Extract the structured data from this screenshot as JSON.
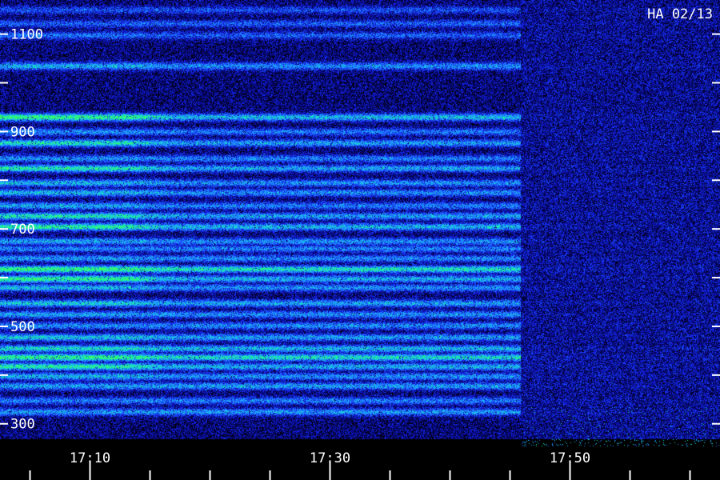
{
  "chart_data": {
    "type": "heatmap",
    "title": "HA 02/13",
    "xlabel": "",
    "ylabel": "",
    "x_tick_labels": [
      "17:10",
      "17:30",
      "17:50"
    ],
    "x_tick_values_min": [
      10,
      30,
      50
    ],
    "x_range_min": [
      2.5,
      62.5
    ],
    "x_minor_tick_step_min": 5,
    "y_tick_labels": [
      "300",
      "500",
      "700",
      "900",
      "1100"
    ],
    "y_tick_values": [
      300,
      500,
      700,
      900,
      1100
    ],
    "y_range": [
      270,
      1170
    ],
    "y_minor_tick_step": 100,
    "signal_cutoff_min": 45.9,
    "colormap": [
      "#000000",
      "#05047a",
      "#1520e8",
      "#1e6cff",
      "#1fb6ff",
      "#12f0a4",
      "#3dff5a"
    ],
    "bands": [
      {
        "y": 325,
        "level": 0.58,
        "early_boost": 0.0
      },
      {
        "y": 348,
        "level": 0.5,
        "early_boost": 0.0
      },
      {
        "y": 378,
        "level": 0.6,
        "early_boost": 0.0
      },
      {
        "y": 398,
        "level": 0.55,
        "early_boost": 0.1
      },
      {
        "y": 418,
        "level": 0.65,
        "early_boost": 0.2
      },
      {
        "y": 437,
        "level": 0.82,
        "early_boost": 0.15
      },
      {
        "y": 455,
        "level": 0.68,
        "early_boost": 0.1
      },
      {
        "y": 478,
        "level": 0.6,
        "early_boost": 0.1
      },
      {
        "y": 502,
        "level": 0.55,
        "early_boost": 0.0
      },
      {
        "y": 525,
        "level": 0.55,
        "early_boost": 0.05
      },
      {
        "y": 548,
        "level": 0.62,
        "early_boost": 0.1
      },
      {
        "y": 580,
        "level": 0.55,
        "early_boost": 0.1
      },
      {
        "y": 598,
        "level": 0.65,
        "early_boost": 0.25
      },
      {
        "y": 618,
        "level": 0.85,
        "early_boost": 0.15
      },
      {
        "y": 640,
        "level": 0.52,
        "early_boost": 0.05
      },
      {
        "y": 660,
        "level": 0.5,
        "early_boost": 0.0
      },
      {
        "y": 675,
        "level": 0.55,
        "early_boost": 0.05
      },
      {
        "y": 705,
        "level": 0.68,
        "early_boost": 0.2
      },
      {
        "y": 727,
        "level": 0.6,
        "early_boost": 0.2
      },
      {
        "y": 748,
        "level": 0.5,
        "early_boost": 0.1
      },
      {
        "y": 775,
        "level": 0.55,
        "early_boost": 0.1
      },
      {
        "y": 795,
        "level": 0.55,
        "early_boost": 0.1
      },
      {
        "y": 825,
        "level": 0.62,
        "early_boost": 0.2
      },
      {
        "y": 845,
        "level": 0.5,
        "early_boost": 0.05
      },
      {
        "y": 877,
        "level": 0.6,
        "early_boost": 0.2
      },
      {
        "y": 900,
        "level": 0.48,
        "early_boost": 0.05
      },
      {
        "y": 930,
        "level": 0.7,
        "early_boost": 0.25
      },
      {
        "y": 1035,
        "level": 0.55,
        "early_boost": 0.1
      },
      {
        "y": 1098,
        "level": 0.4,
        "early_boost": 0.05
      },
      {
        "y": 1122,
        "level": 0.4,
        "early_boost": 0.0
      },
      {
        "y": 1150,
        "level": 0.35,
        "early_boost": 0.0
      }
    ]
  }
}
